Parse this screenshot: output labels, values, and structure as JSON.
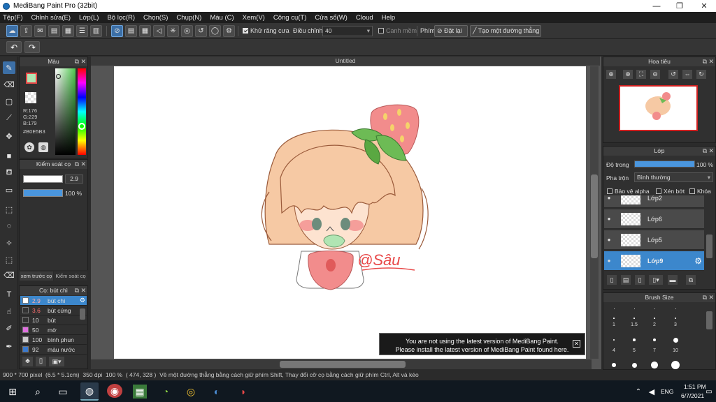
{
  "window": {
    "title": "MediBang Paint Pro (32bit)",
    "controls": [
      "—",
      "❐",
      "✕"
    ]
  },
  "menu": [
    "Tệp(F)",
    "Chỉnh sửa(E)",
    "Lớp(L)",
    "Bộ lọc(R)",
    "Chọn(S)",
    "Chụp(N)",
    "Màu (C)",
    "Xem(V)",
    "Công cụ(T)",
    "Cửa sổ(W)",
    "Cloud",
    "Help"
  ],
  "toolbar": {
    "antialias_label": "Khử răng cưa",
    "antialias_checked": true,
    "adjust_label": "Điều chỉnh",
    "adjust_value": "40",
    "smooth_label": "Canh mềm",
    "smooth_checked": false,
    "key_label": "Phím",
    "reset_label": "Đặt lại",
    "create_line_label": "Tạo một đường thẳng"
  },
  "color_panel": {
    "title": "Màu",
    "r": "R:176",
    "g": "G:229",
    "b": "B:179",
    "hex": "#B0E5B3",
    "fg_color": "#e84848",
    "bg_color": "#ffffff",
    "current_color": "#B0E5B3"
  },
  "control_panel": {
    "title": "Kiểm soát cọ",
    "size_value": "2.9",
    "opacity_value": "100 %"
  },
  "panel_tabs": [
    "xem trước cọ",
    "Kiểm soát cọ"
  ],
  "brush_panel": {
    "title": "Cọ: bút chì",
    "brushes": [
      {
        "size": "2.9",
        "name": "bút chì",
        "color": "#ffffff",
        "selected": true
      },
      {
        "size": "3.6",
        "name": "bút cứng",
        "color": "#333333",
        "selected": false
      },
      {
        "size": "10",
        "name": "bút",
        "color": "#333333",
        "selected": false
      },
      {
        "size": "50",
        "name": "mờ",
        "color": "#e070e0",
        "selected": false
      },
      {
        "size": "100",
        "name": "bình phun",
        "color": "#cccccc",
        "selected": false
      },
      {
        "size": "92",
        "name": "màu nước",
        "color": "#3a7ad0",
        "selected": false
      }
    ]
  },
  "document": {
    "tab": "Untitled",
    "watermark": "@Sâu"
  },
  "navigator": {
    "title": "Hoa tiêu"
  },
  "layer_panel": {
    "title": "Lớp",
    "opacity_label": "Độ trong",
    "opacity_value": "100 %",
    "opacity_fraction": 1.0,
    "blend_label": "Pha trộn",
    "blend_value": "Bình thường",
    "protect_alpha": "Bảo vệ alpha",
    "clipping": "Xén bớt",
    "lock": "Khóa",
    "layers": [
      {
        "name": "Lớp2",
        "selected": false
      },
      {
        "name": "Lớp6",
        "selected": false
      },
      {
        "name": "Lớp5",
        "selected": false
      },
      {
        "name": "Lớp9",
        "selected": true
      }
    ]
  },
  "brush_size_panel": {
    "title": "Brush Size",
    "sizes_row1": [
      "1",
      "1.5",
      "2",
      "3"
    ],
    "sizes_row2": [
      "4",
      "5",
      "7",
      "10"
    ]
  },
  "notification": {
    "line1": "You are not using the latest version of MediBang Paint.",
    "line2": "Please install the latest version of MediBang Paint found here."
  },
  "status": {
    "size": "900 * 700 pixel",
    "physical": "(6.5 * 5.1cm)",
    "dpi": "350 dpi",
    "zoom": "100 %",
    "coords": "( 474, 328 )",
    "hint": "Vẽ một đường thẳng bằng cách giữ phím Shift, Thay đổi cỡ cọ bằng cách giữ phím Ctrl, Alt và kéo"
  },
  "taskbar": {
    "lang": "ENG",
    "time": "1:51 PM",
    "date": "6/7/2021"
  }
}
